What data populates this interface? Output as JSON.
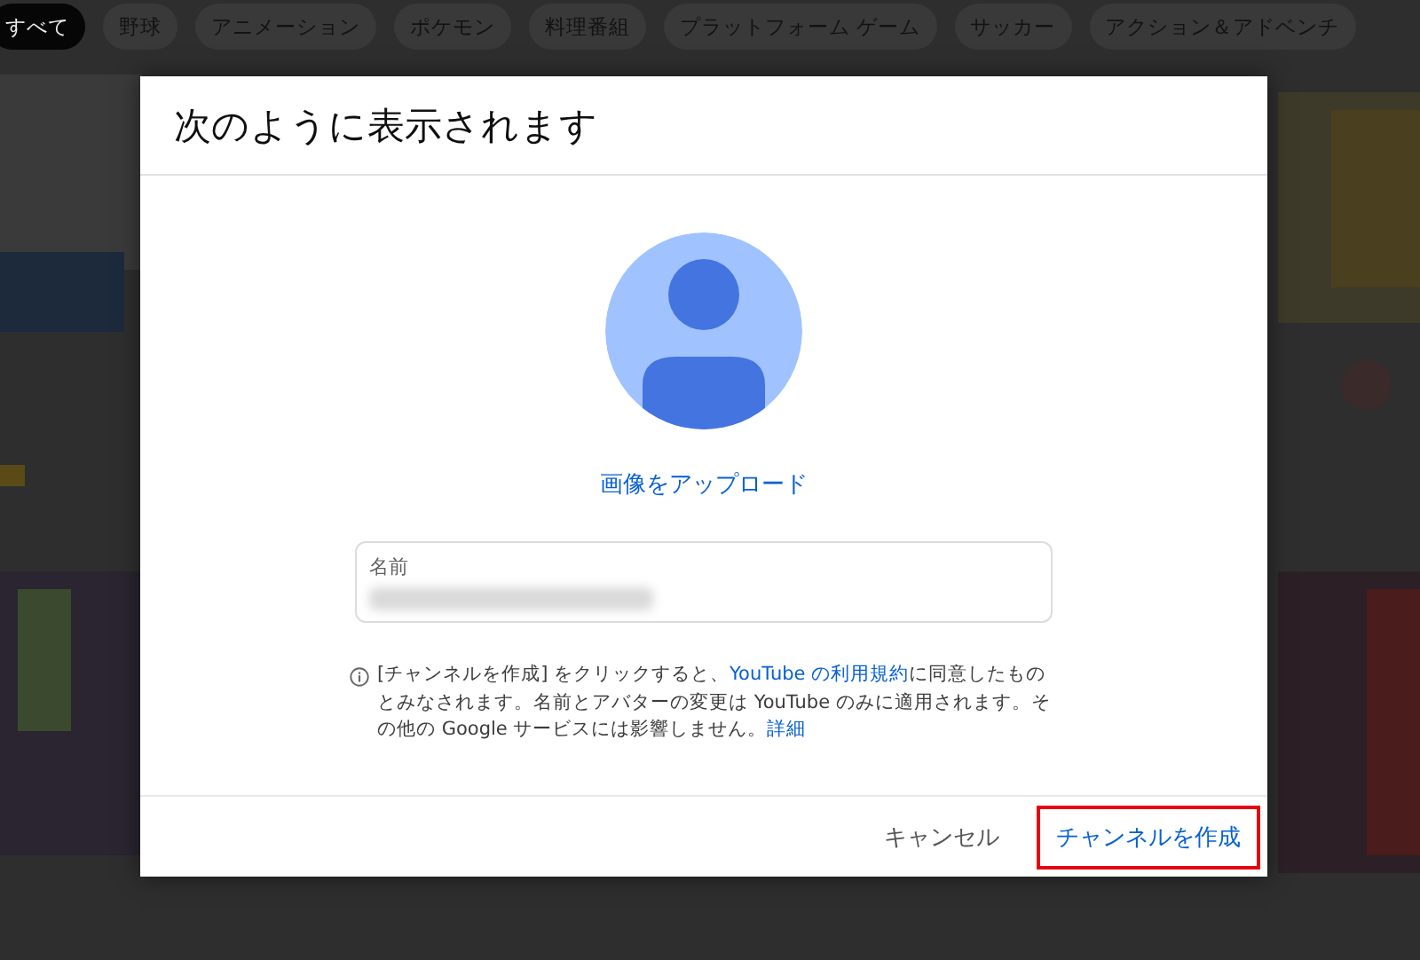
{
  "chips": [
    {
      "label": "すべて",
      "selected": true
    },
    {
      "label": "野球",
      "selected": false
    },
    {
      "label": "アニメーション",
      "selected": false
    },
    {
      "label": "ポケモン",
      "selected": false
    },
    {
      "label": "料理番組",
      "selected": false
    },
    {
      "label": "プラットフォーム ゲーム",
      "selected": false
    },
    {
      "label": "サッカー",
      "selected": false
    },
    {
      "label": "アクション＆アドベンチ",
      "selected": false
    }
  ],
  "dialog": {
    "title": "次のように表示されます",
    "upload_link": "画像をアップロード",
    "name_field": {
      "label": "名前"
    },
    "notice": [
      {
        "kind": "text",
        "text": "[チャンネルを作成] をクリックすると、"
      },
      {
        "kind": "link",
        "text": "YouTube の利用規約"
      },
      {
        "kind": "text",
        "text": "に同意したものとみなされます。名前とアバターの変更は YouTube のみに適用されます。その他の Google サービスには影響しません。"
      },
      {
        "kind": "link",
        "text": "詳細"
      }
    ],
    "buttons": [
      {
        "label": "キャンセル",
        "kind": "secondary",
        "highlighted": false
      },
      {
        "label": "チャンネルを作成",
        "kind": "primary",
        "highlighted": true
      }
    ]
  }
}
